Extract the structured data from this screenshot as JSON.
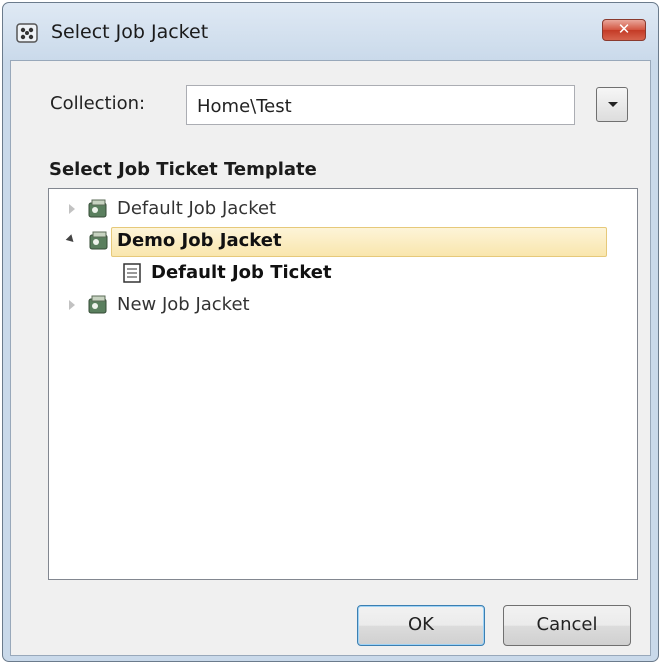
{
  "window": {
    "title": "Select Job Jacket",
    "close_label": "✕"
  },
  "collection": {
    "label": "Collection:",
    "value": "Home\\Test"
  },
  "tree_section": {
    "heading": "Select Job Ticket Template",
    "nodes": [
      {
        "label": "Default Job Jacket",
        "state": "collapsed"
      },
      {
        "label": "Demo Job Jacket",
        "state": "expanded",
        "selected": true,
        "children": [
          {
            "label": "Default Job Ticket"
          }
        ]
      },
      {
        "label": "New Job Jacket",
        "state": "collapsed"
      }
    ]
  },
  "buttons": {
    "ok": "OK",
    "cancel": "Cancel"
  },
  "colors": {
    "selection": "#f9e6ad",
    "close_button": "#d2543f",
    "default_button_border": "#3c7fb1"
  }
}
